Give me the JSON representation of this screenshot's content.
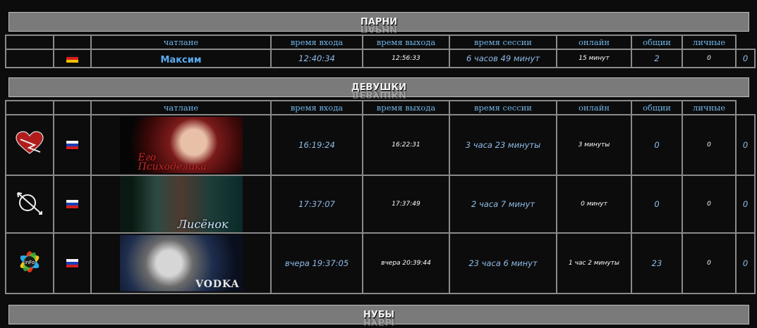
{
  "sections": {
    "guys": "ПАРНИ",
    "girls": "ДЕВУШКИ",
    "noobs": "НУБЫ"
  },
  "columns": [
    "чатлане",
    "время входа",
    "время выхода",
    "время сессии",
    "онлайн",
    "общии",
    "личные"
  ],
  "guys_rows": [
    {
      "flag": "de",
      "name": "Максим",
      "login": "12:40:34",
      "logout": "12:56:33",
      "session": "6 часов 49 минут",
      "online": "15 минут",
      "public": "2",
      "private": "0",
      "last": "0"
    }
  ],
  "girls_rows": [
    {
      "avatar": "heart-icon",
      "flag": "ru",
      "banner_text": "Его\nПсиходелика",
      "login": "16:19:24",
      "logout": "16:22:31",
      "session": "3 часа 23 минуты",
      "online": "3 минуты",
      "public": "0",
      "private": "0",
      "last": "0"
    },
    {
      "avatar": "arrow-icon",
      "flag": "ru",
      "banner_text": "Лисёнок",
      "login": "17:37:07",
      "logout": "17:37:49",
      "session": "2 часа 7 минут",
      "online": "0 минут",
      "public": "0",
      "private": "0",
      "last": "0"
    },
    {
      "avatar": "info-icon",
      "flag": "ru",
      "banner_text": "VODKA",
      "login": "вчера 19:37:05",
      "logout": "вчера 20:39:44",
      "session": "23 часа 6 минут",
      "online": "1 час 2 минуты",
      "public": "23",
      "private": "0",
      "last": "0"
    }
  ]
}
